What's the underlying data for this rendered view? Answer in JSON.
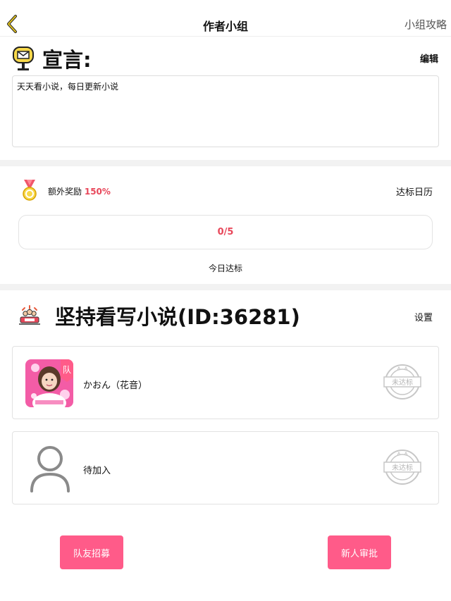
{
  "nav": {
    "title": "作者小组",
    "right_link": "小组攻略",
    "back_icon": "chevron-left-icon"
  },
  "manifesto": {
    "title": "宣言:",
    "edit_label": "编辑",
    "text": "天天看小说，每日更新小说",
    "icon": "mailbox-icon"
  },
  "reward": {
    "label": "额外奖励",
    "percent": "150%",
    "calendar_link": "达标日历",
    "progress_text": "0/5",
    "today_label": "今日达标",
    "icon": "medal-icon"
  },
  "group": {
    "title": "坚持看写小说(ID:36281)",
    "settings_label": "设置",
    "icon": "group-team-icon"
  },
  "members": [
    {
      "name": "かおん（花音）",
      "badge": "队",
      "stamp_text": "未达标",
      "avatar": "member-photo-avatar"
    },
    {
      "name": "待加入",
      "stamp_text": "未达标",
      "avatar": "person-placeholder-icon"
    }
  ],
  "buttons": {
    "recruit": "队友招募",
    "approve": "新人审批"
  },
  "colors": {
    "accent_pink": "#ff5b89",
    "highlight_red": "#e8475a",
    "back_arrow": "#c8a200",
    "divider": "#f2f2f2"
  }
}
